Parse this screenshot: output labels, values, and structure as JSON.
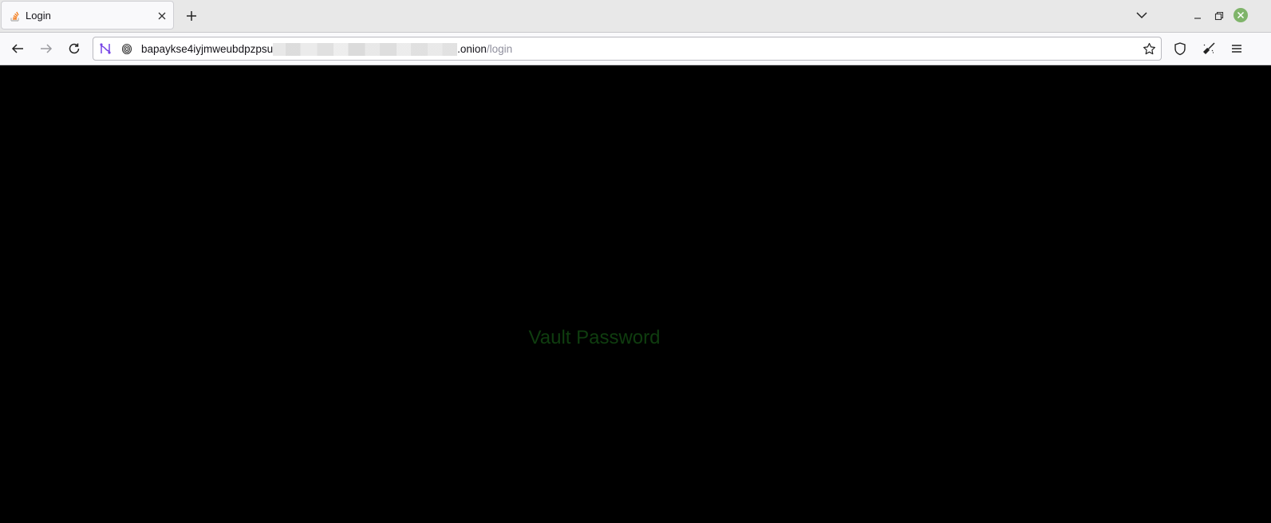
{
  "tab": {
    "title": "Login"
  },
  "urlbar": {
    "host_visible": "bapaykse4iyjmweubdpzpsu",
    "host_suffix": ".onion",
    "path": "/login"
  },
  "page": {
    "heading": "Vault Password",
    "heading_color": "#0f3d0f",
    "background": "#000000"
  },
  "icons": {
    "favicon": "stack-favicon-icon",
    "onion": "onion-circuit-icon",
    "fingerprint": "fingerprint-icon",
    "bookmark": "star-icon",
    "shield": "shield-icon",
    "new_identity": "broom-icon",
    "menu": "hamburger-menu-icon"
  }
}
